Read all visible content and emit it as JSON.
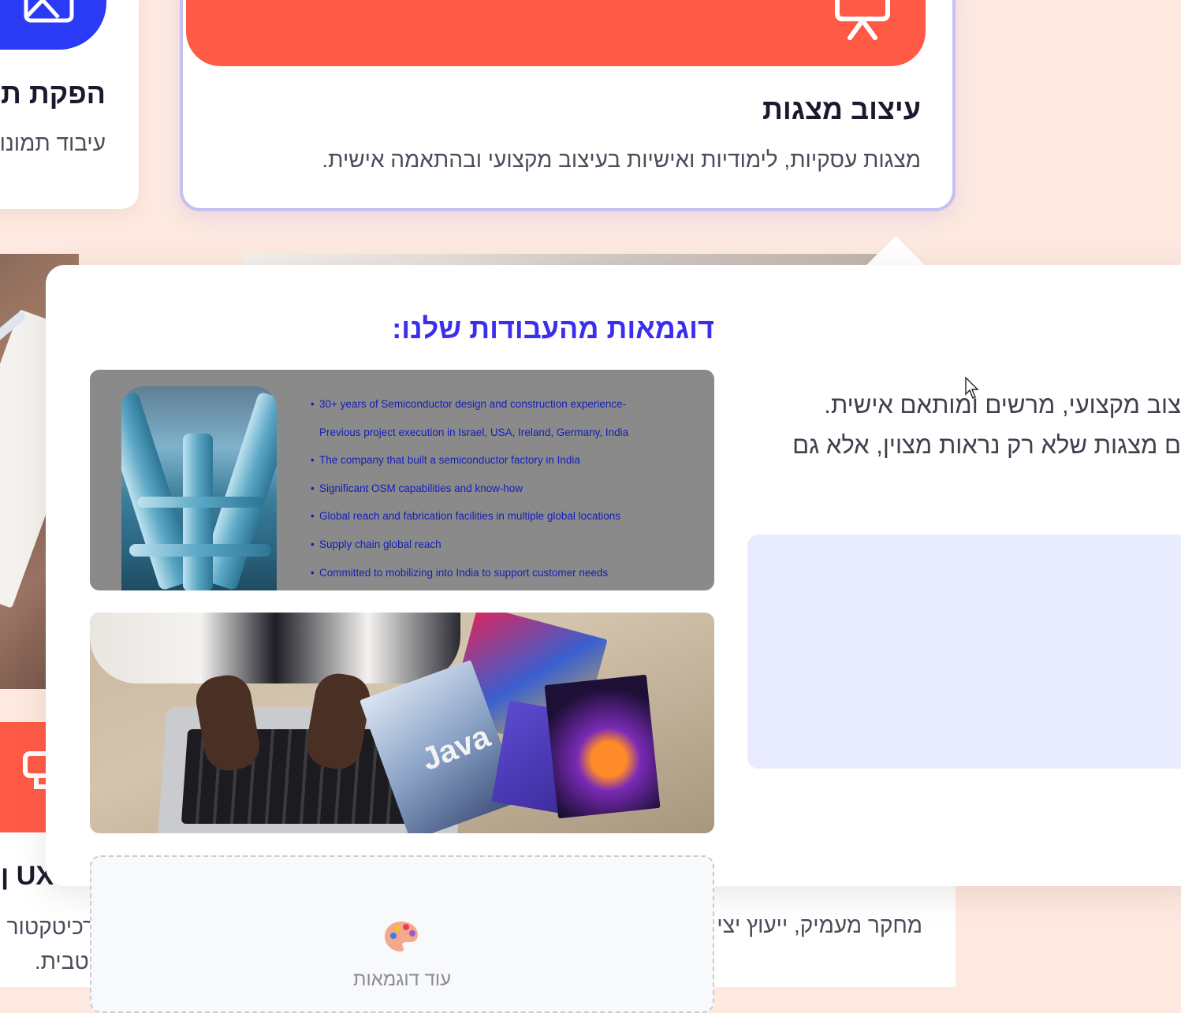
{
  "cards_top": {
    "left": {
      "title": "הפקת ת",
      "desc": "עיבוד תמונו"
    },
    "main": {
      "title": "עיצוב מצגות",
      "desc": "מצגות עסקיות, לימודיות ואישיות בעיצוב מקצועי ובהתאמה אישית."
    }
  },
  "cards_bottom": {
    "left_title": "UX ן",
    "left_desc_line1": "רכיטקטור",
    "left_desc_line2": "יטבית.",
    "right_desc": "מחקר מעמיק, ייעוץ יצי"
  },
  "modal": {
    "gallery_title": "דוגמאות מהעבודות שלנו:",
    "description_lines": [
      "צוב מקצועי, מרשים ומותאם אישית.",
      "ם מצגות שלא רק נראות מצוין, אלא גם"
    ],
    "slide_bullets": [
      {
        "text": "30+ years of Semiconductor design and construction experience-",
        "bullet": true
      },
      {
        "text": "Previous project execution in Israel, USA, Ireland, Germany, India",
        "bullet": false
      },
      {
        "text": "The company that built a semiconductor factory in India",
        "bullet": true
      },
      {
        "text": "Significant OSM capabilities and know-how",
        "bullet": true
      },
      {
        "text": "Global reach and fabrication facilities in multiple global locations",
        "bullet": true
      },
      {
        "text": "Supply chain global reach",
        "bullet": true
      },
      {
        "text": "Committed to mobilizing into India to support customer needs",
        "bullet": true
      }
    ],
    "photo_book_text": "Java",
    "more_label": "עוד דוגמאות",
    "more_icon": "palette-icon"
  },
  "colors": {
    "background": "#fde9e0",
    "accent_blue": "#2b3bf5",
    "accent_orange": "#ff5a45",
    "title_purple": "#3a2ff0",
    "video_placeholder": "#e9ecfe"
  }
}
